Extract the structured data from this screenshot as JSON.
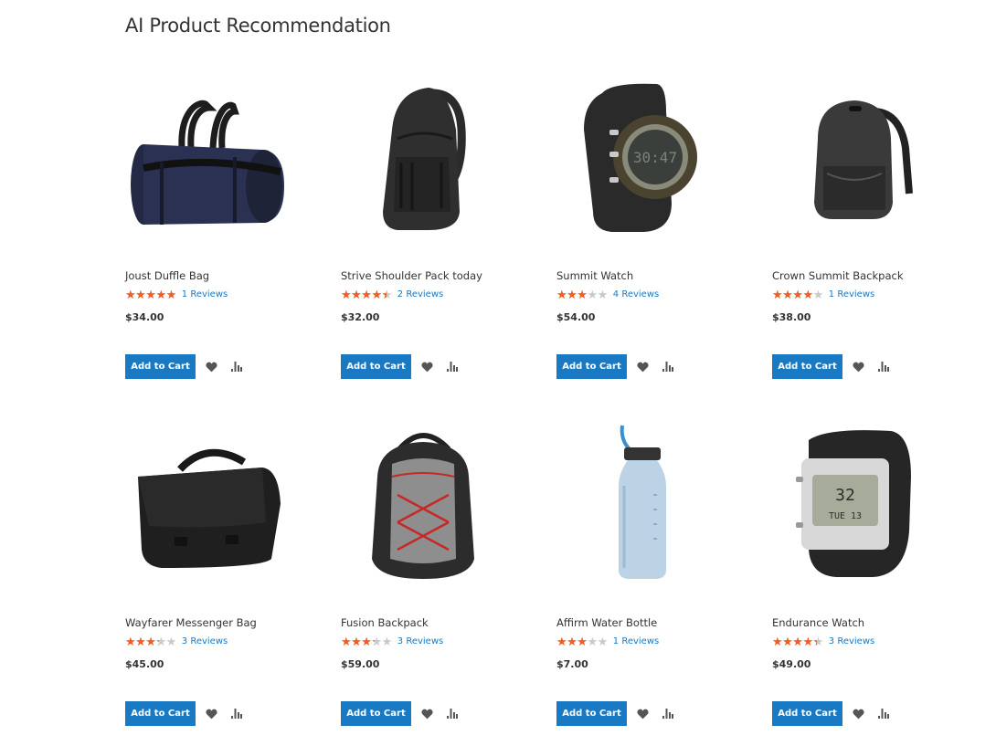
{
  "page": {
    "title": "AI Product Recommendation"
  },
  "colors": {
    "accent": "#1979c3",
    "star": "#f15c22",
    "star_empty": "#c9c9c9",
    "price": "#333333"
  },
  "products": [
    {
      "name": "Joust Duffle Bag",
      "rating_fraction": 1.0,
      "reviews": "1 Reviews",
      "price": "$34.00",
      "image_icon": "duffle-bag-icon",
      "add_to_cart": "Add to Cart"
    },
    {
      "name": "Strive Shoulder Pack today",
      "rating_fraction": 0.9,
      "reviews": "2 Reviews",
      "price": "$32.00",
      "image_icon": "sling-pack-icon",
      "add_to_cart": "Add to Cart"
    },
    {
      "name": "Summit Watch",
      "rating_fraction": 0.6,
      "reviews": "4 Reviews",
      "price": "$54.00",
      "image_icon": "watch-icon",
      "add_to_cart": "Add to Cart"
    },
    {
      "name": "Crown Summit Backpack",
      "rating_fraction": 0.8,
      "reviews": "1 Reviews",
      "price": "$38.00",
      "image_icon": "backpack-icon",
      "add_to_cart": "Add to Cart"
    },
    {
      "name": "Wayfarer Messenger Bag",
      "rating_fraction": 0.67,
      "reviews": "3 Reviews",
      "price": "$45.00",
      "image_icon": "messenger-bag-icon",
      "add_to_cart": "Add to Cart"
    },
    {
      "name": "Fusion Backpack",
      "rating_fraction": 0.67,
      "reviews": "3 Reviews",
      "price": "$59.00",
      "image_icon": "backpack-icon",
      "add_to_cart": "Add to Cart"
    },
    {
      "name": "Affirm Water Bottle",
      "rating_fraction": 0.6,
      "reviews": "1 Reviews",
      "price": "$7.00",
      "image_icon": "water-bottle-icon",
      "add_to_cart": "Add to Cart"
    },
    {
      "name": "Endurance Watch",
      "rating_fraction": 0.87,
      "reviews": "3 Reviews",
      "price": "$49.00",
      "image_icon": "watch-icon",
      "add_to_cart": "Add to Cart"
    }
  ],
  "icons": {
    "wishlist": "heart-icon",
    "compare": "bar-chart-icon",
    "star": "★"
  }
}
